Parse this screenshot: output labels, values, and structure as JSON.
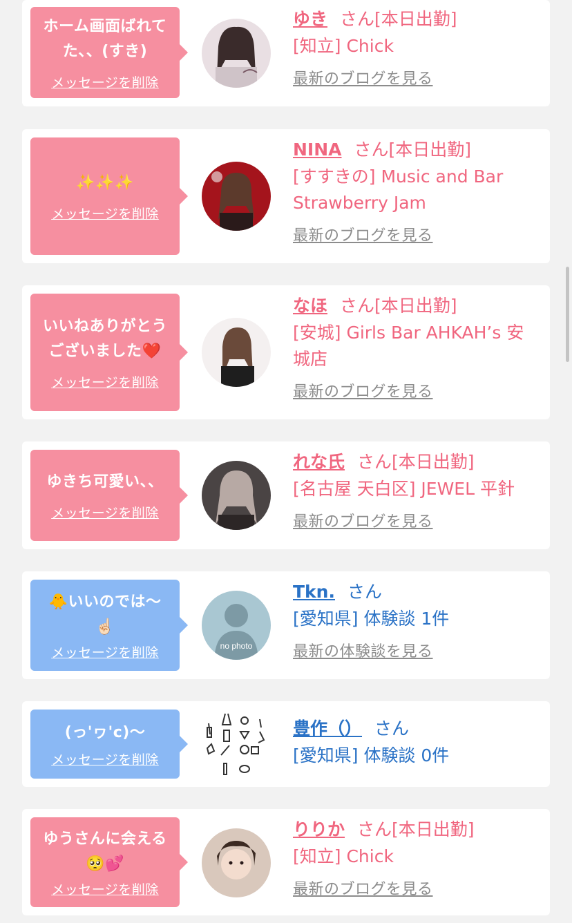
{
  "delete_label": "メッセージを削除",
  "colors": {
    "pink_bubble": "#f68fa0",
    "blue_bubble": "#8ab8f4",
    "pink_text": "#f0667f",
    "blue_text": "#2a72c6",
    "gray_link": "#8c8c8c"
  },
  "messages": [
    {
      "message": "ホーム画面ばれて\nた、、(すき)",
      "name": "ゆき",
      "suffix": "さん[本日出勤]",
      "store": "[知立] Chick",
      "link": "最新のブログを見る",
      "avatar_icon": "girl-photo-avatar-icon"
    },
    {
      "message": "✨✨✨",
      "name": "NINA",
      "suffix": "さん[本日出勤]",
      "store": "[すすきの] Music and Bar\nStrawberry Jam",
      "link": "最新のブログを見る",
      "avatar_icon": "girl-photo-avatar-icon"
    },
    {
      "message": "いいねありがとう\nございました❤️",
      "name": "なほ",
      "suffix": "さん[本日出勤]",
      "store": "[安城] Girls Bar AHKAH’s 安城店",
      "link": "最新のブログを見る",
      "avatar_icon": "girl-photo-avatar-icon"
    },
    {
      "message": "ゆきち可愛い、、",
      "name": "れな氏",
      "suffix": "さん[本日出勤]",
      "store": "[名古屋 天白区] JEWEL 平針",
      "link": "最新のブログを見る",
      "avatar_icon": "girl-photo-avatar-icon"
    },
    {
      "message": "🐥いいのでは〜\n☝🏻",
      "name": "Tkn.",
      "suffix": "さん",
      "store": "[愛知県] 体験談 1件",
      "link": "最新の体験談を見る",
      "avatar_icon": "no-photo-avatar-icon",
      "avatar_text": "no photo"
    },
    {
      "message": "(っ'ヮ'c)〜",
      "name": "豊作（）",
      "suffix": "さん",
      "store": "[愛知県] 体験談 0件",
      "link": "",
      "avatar_icon": "lab-equipment-avatar-icon"
    },
    {
      "message": "ゆうさんに会える\n🥺💕",
      "name": "りりか",
      "suffix": "さん[本日出勤]",
      "store": "[知立] Chick",
      "link": "最新のブログを見る",
      "avatar_icon": "girl-photo-avatar-icon"
    }
  ]
}
